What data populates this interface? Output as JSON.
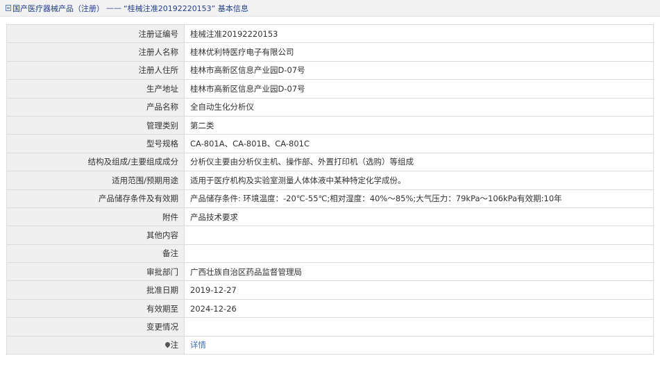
{
  "breadcrumb": {
    "root": "国产医疗器械产品（注册）",
    "separator": "——",
    "current": "“桂械注准20192220153” 基本信息"
  },
  "fields": {
    "registration_no": {
      "label": "注册证编号",
      "value": "桂械注准20192220153"
    },
    "registrant_name": {
      "label": "注册人名称",
      "value": "桂林优利特医疗电子有限公司"
    },
    "registrant_address": {
      "label": "注册人住所",
      "value": "桂林市高新区信息产业园D-07号"
    },
    "production_address": {
      "label": "生产地址",
      "value": "桂林市高新区信息产业园D-07号"
    },
    "product_name": {
      "label": "产品名称",
      "value": "全自动生化分析仪"
    },
    "management_class": {
      "label": "管理类别",
      "value": "第二类"
    },
    "model_spec": {
      "label": "型号规格",
      "value": "CA-801A、CA-801B、CA-801C"
    },
    "structure": {
      "label": "结构及组成/主要组成成分",
      "value": "分析仪主要由分析仪主机、操作部、外置打印机（选购）等组成"
    },
    "scope": {
      "label": "适用范围/预期用途",
      "value": "适用于医疗机构及实验室测量人体体液中某种特定化学成份。"
    },
    "storage": {
      "label": "产品储存条件及有效期",
      "value": "产品储存条件: 环境温度：-20℃-55℃;相对湿度：40%～85%;大气压力：79kPa～106kPa有效期:10年"
    },
    "attachment": {
      "label": "附件",
      "value": "产品技术要求"
    },
    "other": {
      "label": "其他内容",
      "value": ""
    },
    "remarks": {
      "label": "备注",
      "value": ""
    },
    "approval_dept": {
      "label": "审批部门",
      "value": "广西壮族自治区药品监督管理局"
    },
    "approval_date": {
      "label": "批准日期",
      "value": "2019-12-27"
    },
    "valid_until": {
      "label": "有效期至",
      "value": "2024-12-26"
    },
    "change": {
      "label": "变更情况",
      "value": ""
    },
    "note": {
      "label": "注",
      "link": "详情",
      "icon": "map-pin-icon"
    }
  },
  "colors": {
    "label_bg": "#f0f0f0",
    "border": "#dcdcdc",
    "link": "#3b6fb8",
    "breadcrumb_text": "#1f3f8c"
  }
}
